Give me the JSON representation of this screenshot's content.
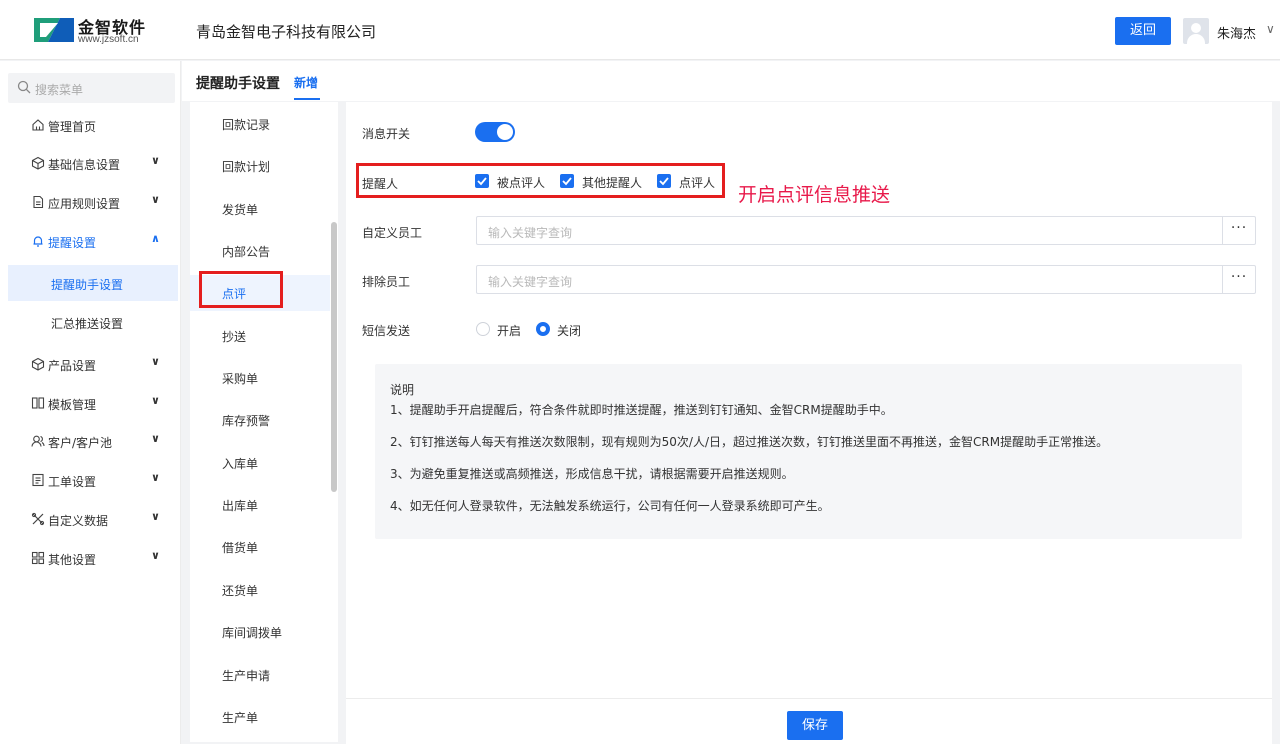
{
  "header": {
    "logo_name": "金智软件",
    "logo_url": "www.jzsoft.cn",
    "company": "青岛金智电子科技有限公司",
    "back_label": "返回",
    "username": "朱海杰",
    "user_caret": "∨"
  },
  "sidebar": {
    "search_placeholder": "搜索菜单",
    "items": [
      {
        "label": "管理首页",
        "icon": "home-icon"
      },
      {
        "label": "基础信息设置",
        "icon": "cube-icon",
        "caret": "∨"
      },
      {
        "label": "应用规则设置",
        "icon": "doc-icon",
        "caret": "∨"
      },
      {
        "label": "提醒设置",
        "icon": "bell-icon",
        "caret": "∧"
      },
      {
        "label": "产品设置",
        "icon": "cube-icon",
        "caret": "∨"
      },
      {
        "label": "模板管理",
        "icon": "template-icon",
        "caret": "∨"
      },
      {
        "label": "客户/客户池",
        "icon": "customer-icon",
        "caret": "∨"
      },
      {
        "label": "工单设置",
        "icon": "ticket-icon",
        "caret": "∨"
      },
      {
        "label": "自定义数据",
        "icon": "tools-icon",
        "caret": "∨"
      },
      {
        "label": "其他设置",
        "icon": "grid-icon",
        "caret": "∨"
      }
    ],
    "sub_items": [
      {
        "label": "提醒助手设置"
      },
      {
        "label": "汇总推送设置"
      }
    ]
  },
  "page": {
    "title": "提醒助手设置",
    "tab": "新增"
  },
  "doc_list": [
    "回款记录",
    "回款计划",
    "发货单",
    "内部公告",
    "点评",
    "抄送",
    "采购单",
    "库存预警",
    "入库单",
    "出库单",
    "借货单",
    "还货单",
    "库间调拨单",
    "生产申请",
    "生产单"
  ],
  "form": {
    "switch_label": "消息开关",
    "switch_on": true,
    "recipient_label": "提醒人",
    "recipients": [
      "被点评人",
      "其他提醒人",
      "点评人"
    ],
    "annotation": "开启点评信息推送",
    "custom_label": "自定义员工",
    "custom_placeholder": "输入关键字查询",
    "exclude_label": "排除员工",
    "exclude_placeholder": "输入关键字查询",
    "more_label": "···",
    "sms_label": "短信发送",
    "sms_on": "开启",
    "sms_off": "关闭",
    "sms_selected": "关闭",
    "save_label": "保存"
  },
  "notes": {
    "title": "说明",
    "lines": [
      "1、提醒助手开启提醒后，符合条件就即时推送提醒，推送到钉钉通知、金智CRM提醒助手中。",
      "2、钉钉推送每人每天有推送次数限制，现有规则为50次/人/日，超过推送次数，钉钉推送里面不再推送，金智CRM提醒助手正常推送。",
      "3、为避免重复推送或高频推送，形成信息干扰，请根据需要开启推送规则。",
      "4、如无任何人登录软件，无法触发系统运行，公司有任何一人登录系统即可产生。"
    ]
  },
  "colors": {
    "primary": "#1a6ff0",
    "highlight": "#e41e1e",
    "annotation": "#e8194a"
  }
}
